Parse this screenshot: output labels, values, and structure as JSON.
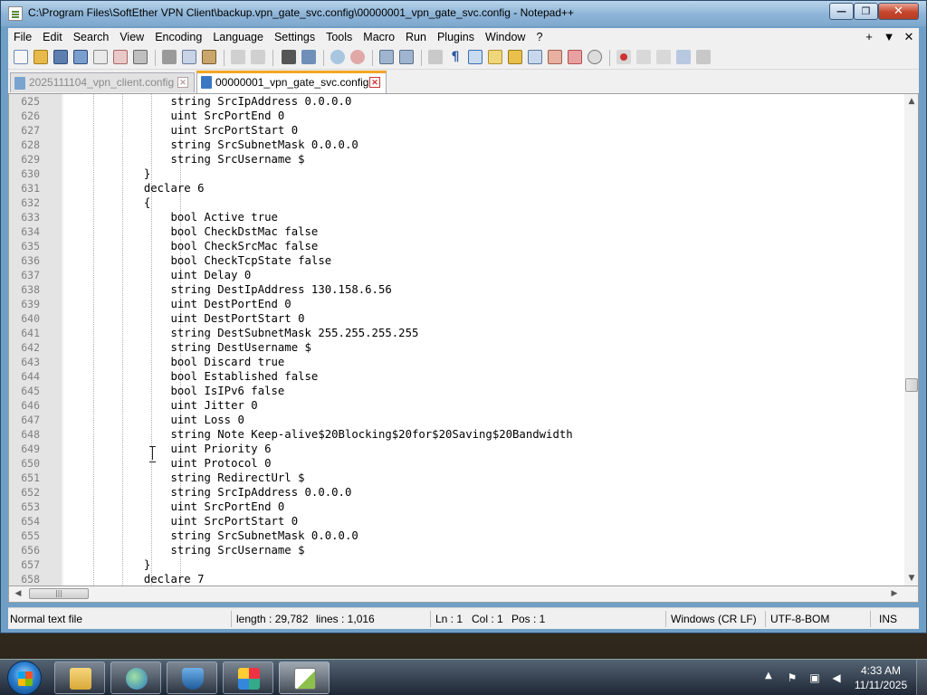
{
  "window": {
    "title": "C:\\Program Files\\SoftEther VPN Client\\backup.vpn_gate_svc.config\\00000001_vpn_gate_svc.config - Notepad++",
    "min_glyph": "—",
    "max_glyph": "❐",
    "close_glyph": "✕"
  },
  "menu": {
    "items": [
      "File",
      "Edit",
      "Search",
      "View",
      "Encoding",
      "Language",
      "Settings",
      "Tools",
      "Macro",
      "Run",
      "Plugins",
      "Window",
      "?"
    ],
    "right": [
      "+",
      "▼",
      "✕"
    ]
  },
  "tabs": [
    {
      "label": "2025111104_vpn_client.config",
      "active": false
    },
    {
      "label": "00000001_vpn_gate_svc.config",
      "active": true
    }
  ],
  "editor": {
    "lines": [
      {
        "n": "625",
        "text": "                string SrcIpAddress 0.0.0.0"
      },
      {
        "n": "626",
        "text": "                uint SrcPortEnd 0"
      },
      {
        "n": "627",
        "text": "                uint SrcPortStart 0"
      },
      {
        "n": "628",
        "text": "                string SrcSubnetMask 0.0.0.0"
      },
      {
        "n": "629",
        "text": "                string SrcUsername $"
      },
      {
        "n": "630",
        "text": "            }"
      },
      {
        "n": "631",
        "text": "            declare 6"
      },
      {
        "n": "632",
        "text": "            {"
      },
      {
        "n": "633",
        "text": "                bool Active true"
      },
      {
        "n": "634",
        "text": "                bool CheckDstMac false"
      },
      {
        "n": "635",
        "text": "                bool CheckSrcMac false"
      },
      {
        "n": "636",
        "text": "                bool CheckTcpState false"
      },
      {
        "n": "637",
        "text": "                uint Delay 0"
      },
      {
        "n": "638",
        "text": "                string DestIpAddress 130.158.6.56"
      },
      {
        "n": "639",
        "text": "                uint DestPortEnd 0"
      },
      {
        "n": "640",
        "text": "                uint DestPortStart 0"
      },
      {
        "n": "641",
        "text": "                string DestSubnetMask 255.255.255.255"
      },
      {
        "n": "642",
        "text": "                string DestUsername $"
      },
      {
        "n": "643",
        "text": "                bool Discard true"
      },
      {
        "n": "644",
        "text": "                bool Established false"
      },
      {
        "n": "645",
        "text": "                bool IsIPv6 false"
      },
      {
        "n": "646",
        "text": "                uint Jitter 0"
      },
      {
        "n": "647",
        "text": "                uint Loss 0"
      },
      {
        "n": "648",
        "text": "                string Note Keep-alive$20Blocking$20for$20Saving$20Bandwidth"
      },
      {
        "n": "649",
        "text": "                uint Priority 6"
      },
      {
        "n": "650",
        "text": "                uint Protocol 0"
      },
      {
        "n": "651",
        "text": "                string RedirectUrl $"
      },
      {
        "n": "652",
        "text": "                string SrcIpAddress 0.0.0.0"
      },
      {
        "n": "653",
        "text": "                uint SrcPortEnd 0"
      },
      {
        "n": "654",
        "text": "                uint SrcPortStart 0"
      },
      {
        "n": "655",
        "text": "                string SrcSubnetMask 0.0.0.0"
      },
      {
        "n": "656",
        "text": "                string SrcUsername $"
      },
      {
        "n": "657",
        "text": "            }"
      },
      {
        "n": "658",
        "text": "            declare 7"
      }
    ]
  },
  "scrollbars": {
    "vertical_position": 0.6,
    "up_glyph": "▲",
    "down_glyph": "▼",
    "left_glyph": "◀",
    "right_glyph": "▶",
    "thumb_grip": "|||"
  },
  "status": {
    "file_type": "Normal text file",
    "length": "length : 29,782",
    "lines": "lines : 1,016",
    "ln": "Ln : 1",
    "col": "Col : 1",
    "pos": "Pos : 1",
    "eol": "Windows (CR LF)",
    "encoding": "UTF-8-BOM",
    "mode": "INS"
  },
  "taskbar": {
    "time": "4:33 AM",
    "date": "11/11/2025",
    "apps": [
      "explorer-icon",
      "network-globe-icon",
      "security-shield-icon",
      "photo-viewer-icon",
      "notepadpp-icon"
    ]
  }
}
